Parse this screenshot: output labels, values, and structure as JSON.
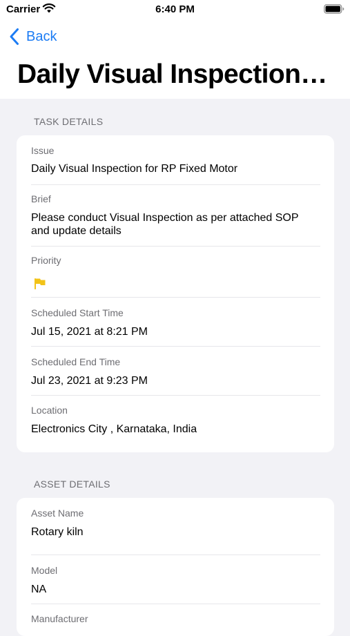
{
  "status_bar": {
    "carrier": "Carrier",
    "time": "6:40 PM"
  },
  "nav": {
    "back_label": "Back"
  },
  "page": {
    "title": "Daily Visual Inspection…"
  },
  "task_details": {
    "header": "TASK DETAILS",
    "issue_label": "Issue",
    "issue_value": "Daily Visual Inspection for RP Fixed Motor",
    "brief_label": "Brief",
    "brief_line1": "Please conduct Visual Inspection as per attached SOP",
    "brief_line2": "and update details",
    "priority_label": "Priority",
    "priority_icon": "flag-icon",
    "priority_color": "#f2c318",
    "start_label": "Scheduled Start Time",
    "start_value": "Jul 15, 2021 at 8:21 PM",
    "end_label": "Scheduled End Time",
    "end_value": "Jul 23, 2021 at 9:23 PM",
    "location_label": "Location",
    "location_value": "Electronics City , Karnataka, India"
  },
  "asset_details": {
    "header": "ASSET DETAILS",
    "asset_name_label": "Asset Name",
    "asset_name_value": "Rotary kiln",
    "model_label": "Model",
    "model_value": "NA",
    "manufacturer_label": "Manufacturer"
  },
  "colors": {
    "accent": "#1c7cf4",
    "background": "#f2f2f6",
    "secondary_text": "#6d6d72"
  }
}
